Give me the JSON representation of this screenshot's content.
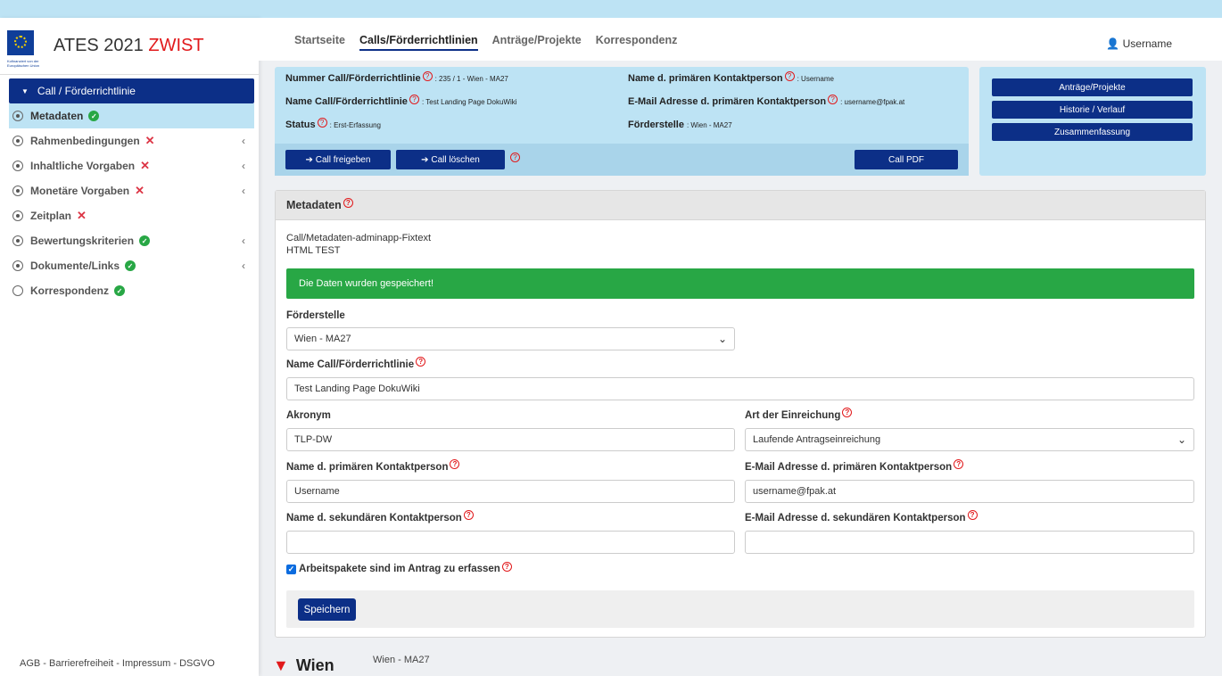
{
  "eu_caption": "Kofinanziert von der Europäischen Union",
  "brand": {
    "title": "ATES 2021",
    "title_accent": "ZWIST"
  },
  "sidebar": {
    "header": "Call / Förderrichtlinie",
    "items": [
      {
        "label": "Metadaten",
        "status": "ok"
      },
      {
        "label": "Rahmenbedingungen",
        "status": "bad"
      },
      {
        "label": "Inhaltliche Vorgaben",
        "status": "bad"
      },
      {
        "label": "Monetäre Vorgaben",
        "status": "bad"
      },
      {
        "label": "Zeitplan",
        "status": "bad"
      },
      {
        "label": "Bewertungskriterien",
        "status": "ok"
      },
      {
        "label": "Dokumente/Links",
        "status": "ok"
      },
      {
        "label": "Korrespondenz",
        "status": "ok"
      }
    ],
    "footer": "AGB - Barrierefreiheit - Impressum - DSGVO"
  },
  "topnav": {
    "tabs": [
      "Startseite",
      "Calls/Förderrichtlinien",
      "Anträge/Projekte",
      "Korrespondenz"
    ],
    "active_tab": "Calls/Förderrichtlinien",
    "user": "Username"
  },
  "info": {
    "nummer_label": "Nummer Call/Förderrichtlinie",
    "nummer_value": ": 235 / 1 - Wien - MA27",
    "name_label": "Name Call/Förderrichtlinie",
    "name_value": ": Test Landing Page DokuWiki",
    "status_label": "Status",
    "status_value": ": Erst-Erfassung",
    "kontakt_label": "Name d. primären Kontaktperson",
    "kontakt_value": ": Username",
    "email_label": "E-Mail Adresse d. primären Kontaktperson",
    "email_value": ": username@fpak.at",
    "foerderstelle_label": "Förderstelle",
    "foerderstelle_value": ": Wien - MA27",
    "btn_freigeben": "Call freigeben",
    "btn_loeschen": "Call löschen",
    "btn_pdf": "Call PDF"
  },
  "actions": [
    "Anträge/Projekte",
    "Historie / Verlauf",
    "Zusammenfassung"
  ],
  "card": {
    "title": "Metadaten",
    "fixtext_line1": "Call/Metadaten-adminapp-Fixtext",
    "fixtext_line2": "HTML TEST",
    "alert": "Die Daten wurden gespeichert!",
    "foerderstelle_label": "Förderstelle",
    "foerderstelle_value": "Wien - MA27",
    "name_label": "Name Call/Förderrichtlinie",
    "name_value": "Test Landing Page DokuWiki",
    "akronym_label": "Akronym",
    "akronym_value": "TLP-DW",
    "art_label": "Art der Einreichung",
    "art_value": "Laufende Antragseinreichung",
    "prim_name_label": "Name d. primären Kontaktperson",
    "prim_name_value": "Username",
    "prim_email_label": "E-Mail Adresse d. primären Kontaktperson",
    "prim_email_value": "username@fpak.at",
    "sek_name_label": "Name d. sekundären Kontaktperson",
    "sek_name_value": "",
    "sek_email_label": "E-Mail Adresse d. sekundären Kontaktperson",
    "sek_email_value": "",
    "checkbox_label": "Arbeitspakete sind im Antrag zu erfassen",
    "save": "Speichern"
  },
  "footer": {
    "logo": "Wien",
    "sub": "Wien - MA27"
  },
  "colors": {
    "primary": "#0c2f87",
    "light_blue": "#bde3f4",
    "success": "#28a745",
    "danger": "#dc3545",
    "brand_red": "#e1191b"
  }
}
